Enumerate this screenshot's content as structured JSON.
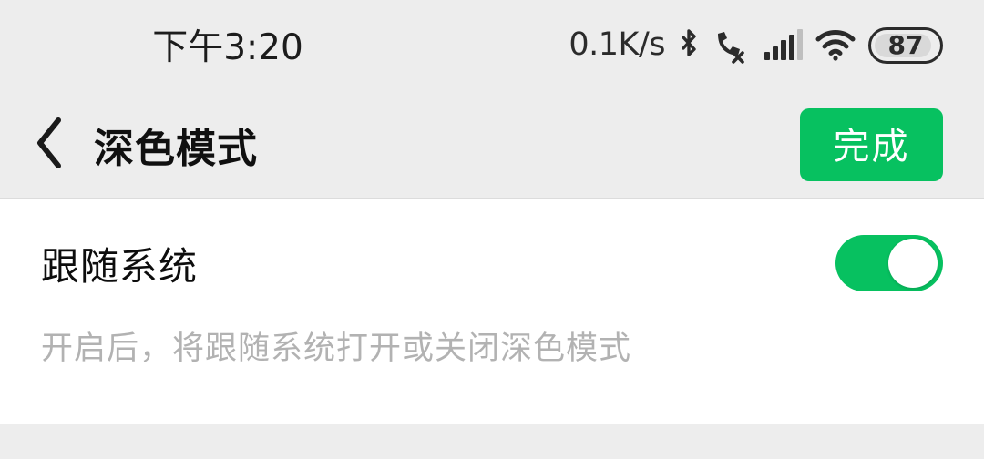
{
  "theme": {
    "accent_green": "#07C160",
    "page_bg": "#EDEDED",
    "card_bg": "#FFFFFF",
    "title_color": "#101010",
    "desc_color": "#B2B2B2"
  },
  "status_bar": {
    "time": "下午3:20",
    "network_speed": "0.1K/s",
    "icons": [
      {
        "name": "bluetooth-icon",
        "label": "蓝牙"
      },
      {
        "name": "call-disabled-icon",
        "label": "通话不可用"
      },
      {
        "name": "cellular-signal-icon",
        "label": "信号",
        "bars_total": 5,
        "bars_filled": 4
      },
      {
        "name": "wifi-icon",
        "label": "WLAN",
        "bars_filled": 3
      }
    ],
    "battery": {
      "name": "battery-icon",
      "level": "87"
    }
  },
  "nav_bar": {
    "back_icon": "chevron-left-icon",
    "title": "深色模式",
    "action_label": "完成"
  },
  "settings": {
    "rows": [
      {
        "label": "跟随系统",
        "description": "开启后，将跟随系统打开或关闭深色模式",
        "toggle_on": true,
        "toggle_state_text": "开"
      }
    ]
  }
}
